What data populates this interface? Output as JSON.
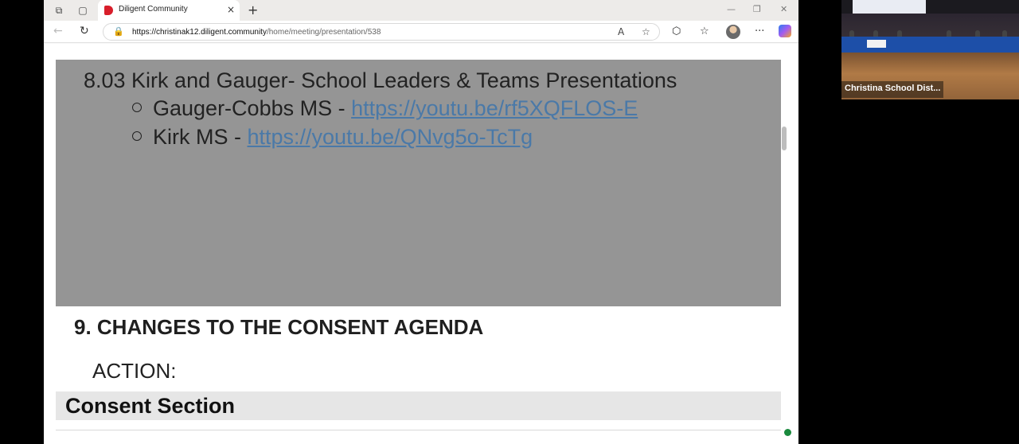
{
  "browser": {
    "tab_title": "Diligent Community",
    "tab_close": "×",
    "new_tab": "+",
    "url_host": "https://christinak12.diligent.community",
    "url_path": "/home/meeting/presentation/538",
    "icons": {
      "workspaces": "⧉",
      "tab_actions": "▢",
      "minimize": "—",
      "restore": "❐",
      "close": "✕",
      "back": "←",
      "refresh": "↻",
      "lock": "🔒",
      "read_aloud": "A",
      "favorite": "☆",
      "extensions": "⬡",
      "favorites_hub": "☆",
      "more": "···"
    }
  },
  "slide": {
    "title": "8.03 Kirk and Gauger- School Leaders & Teams Presentations",
    "items": [
      {
        "label": "Gauger-Cobbs MS - ",
        "link": "https://youtu.be/rf5XQFLOS-E"
      },
      {
        "label": "Kirk MS - ",
        "link": "https://youtu.be/QNvg5o-TcTg"
      }
    ]
  },
  "agenda": {
    "section_title": "9. CHANGES TO THE CONSENT AGENDA",
    "action_label": "ACTION:",
    "consent_heading": "Consent Section"
  },
  "video": {
    "label": "Christina School Dist..."
  }
}
